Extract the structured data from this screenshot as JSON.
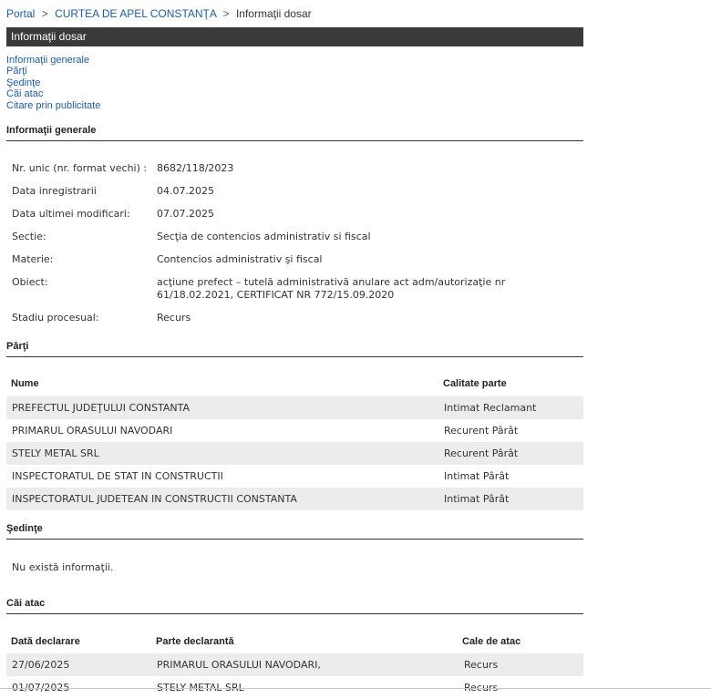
{
  "breadcrumb": {
    "portal": "Portal",
    "court": "CURTEA DE APEL CONSTANŢA",
    "current": "Informaţii dosar",
    "separator": ">"
  },
  "title": "Informaţii dosar",
  "anchors": [
    "Informaţii generale",
    "Părţi",
    "Şedinţe",
    "Căi atac",
    "Citare prin publicitate"
  ],
  "general": {
    "heading": "Informaţii generale",
    "fields": [
      {
        "label": "Nr. unic (nr. format vechi) :",
        "value": "8682/118/2023"
      },
      {
        "label": "Data inregistrarii",
        "value": "04.07.2025"
      },
      {
        "label": "Data ultimei modificari:",
        "value": "07.07.2025"
      },
      {
        "label": "Sectie:",
        "value": "Secţia de contencios administrativ si fiscal"
      },
      {
        "label": "Materie:",
        "value": "Contencios administrativ şi fiscal"
      },
      {
        "label": "Obiect:",
        "value": "acţiune prefect – tutelă administrativă anulare act adm/autorizaţie nr 61/18.02.2021, CERTIFICAT NR 772/15.09.2020"
      },
      {
        "label": "Stadiu procesual:",
        "value": "Recurs"
      }
    ]
  },
  "parti": {
    "heading": "Părţi",
    "columns": [
      "Nume",
      "Calitate parte"
    ],
    "rows": [
      [
        "PREFECTUL JUDEŢULUI CONSTANTA",
        "Intimat Reclamant"
      ],
      [
        "PRIMARUL ORASULUI NAVODARI",
        "Recurent Pârât"
      ],
      [
        "STELY METAL SRL",
        "Recurent Pârât"
      ],
      [
        "INSPECTORATUL DE STAT IN CONSTRUCTII",
        "Intimat Pârât"
      ],
      [
        "INSPECTORATUL JUDETEAN IN CONSTRUCTII CONSTANTA",
        "Intimat Pârât"
      ]
    ]
  },
  "sedinte": {
    "heading": "Şedinţe",
    "empty_text": "Nu există informaţii."
  },
  "cai_atac": {
    "heading": "Căi atac",
    "columns": [
      "Dată declarare",
      "Parte declarantă",
      "Cale de atac"
    ],
    "rows": [
      [
        "27/06/2025",
        "PRIMARUL ORASULUI NAVODARI,",
        "Recurs"
      ],
      [
        "01/07/2025",
        "STELY METAL SRL",
        "Recurs"
      ]
    ]
  },
  "colors": {
    "link": "#1b5c9e",
    "title_bar": "#3a3a3a",
    "row_alt": "#ececec"
  }
}
